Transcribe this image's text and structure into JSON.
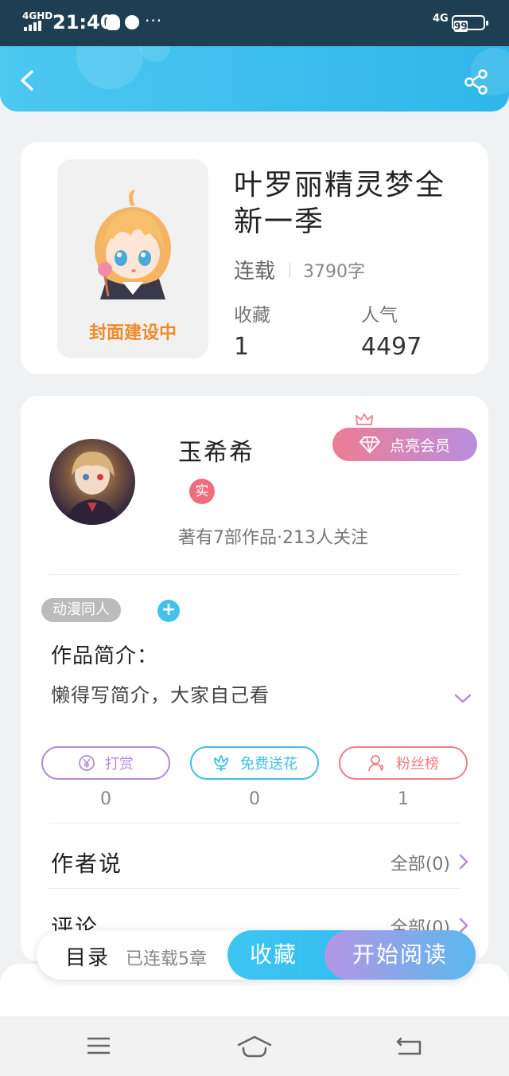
{
  "status_bar": {
    "network_left": "4GHD",
    "time": "21:40",
    "more_dots": "···",
    "network_right": "4G",
    "battery": "99"
  },
  "book": {
    "title": "叶罗丽精灵梦全新一季",
    "cover_placeholder": "封面建设中",
    "state": "连载",
    "word_count": "3790字",
    "favorites_label": "收藏",
    "favorites_value": "1",
    "popularity_label": "人气",
    "popularity_value": "4497"
  },
  "author": {
    "name": "玉希希",
    "vip_button": "点亮会员",
    "verified_badge": "实",
    "stats": "著有7部作品·213人关注"
  },
  "tags": [
    "动漫同人"
  ],
  "tag_add": "+",
  "intro": {
    "title": "作品简介：",
    "text": "懒得写简介，大家自己看"
  },
  "actions": [
    {
      "label": "打赏",
      "count": "0",
      "icon": "yen-coin-icon",
      "color": "#b28ad6"
    },
    {
      "label": "免费送花",
      "count": "0",
      "icon": "flower-icon",
      "color": "#3fc0e6"
    },
    {
      "label": "粉丝榜",
      "count": "1",
      "icon": "fan-person-icon",
      "color": "#ef7d86"
    }
  ],
  "sections": {
    "author_says": "作者说",
    "author_says_more": "全部(0)",
    "comments": "评论",
    "comments_more": "全部(0)"
  },
  "bottom_bar": {
    "toc": "目录",
    "chapters": "已连载5章",
    "favorite": "收藏",
    "start_reading": "开始阅读"
  },
  "colors": {
    "header": "#33b9ec",
    "accent_blue": "#3ec6f2",
    "vip_gradient_start": "#ee7d93",
    "vip_gradient_end": "#b98de0",
    "cover_text": "#f08a28"
  },
  "icons": {
    "back": "back-arrow-icon",
    "share": "share-icon",
    "crown": "crown-icon",
    "diamond": "diamond-icon",
    "expand": "chevron-down-icon",
    "menu": "menu-icon",
    "home": "home-icon",
    "return": "return-icon"
  }
}
